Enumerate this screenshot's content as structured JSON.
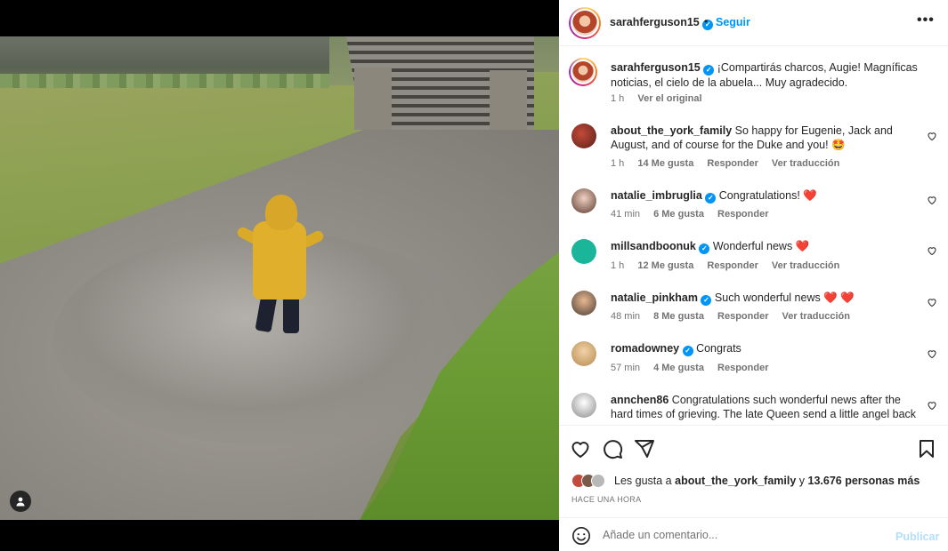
{
  "post": {
    "author": "sarahferguson15",
    "follow_label": "Seguir",
    "dot": "•",
    "more": "•••",
    "caption": "¡Compartirás charcos, Augie! Magníficas noticias, el cielo de la abuela... Muy agradecido.",
    "caption_time": "1 h",
    "caption_translate": "Ver el original"
  },
  "comments": [
    {
      "user": "about_the_york_family",
      "verified": false,
      "text": "So happy for Eugenie, Jack and August, and of course for the Duke and you! 🤩",
      "time": "1 h",
      "likes": "14 Me gusta",
      "reply": "Responder",
      "translate": "Ver traducción"
    },
    {
      "user": "natalie_imbruglia",
      "verified": true,
      "text": "Congratulations! ❤️",
      "time": "41 min",
      "likes": "6 Me gusta",
      "reply": "Responder"
    },
    {
      "user": "millsandboonuk",
      "verified": true,
      "text": "Wonderful news ❤️",
      "time": "1 h",
      "likes": "12 Me gusta",
      "reply": "Responder",
      "translate": "Ver traducción"
    },
    {
      "user": "natalie_pinkham",
      "verified": true,
      "text": "Such wonderful news ❤️ ❤️",
      "time": "48 min",
      "likes": "8 Me gusta",
      "reply": "Responder",
      "translate": "Ver traducción"
    },
    {
      "user": "romadowney",
      "verified": true,
      "text": "Congrats",
      "time": "57 min",
      "likes": "4 Me gusta",
      "reply": "Responder"
    },
    {
      "user": "annchen86",
      "verified": false,
      "text": "Congratulations such wonderful news after the hard times of grieving. The late Queen send a little angel back"
    }
  ],
  "likes": {
    "prefix": "Les gusta a",
    "first_liker": "about_the_york_family",
    "joiner": "y",
    "others": "13.676 personas más"
  },
  "time_ago": "HACE UNA HORA",
  "add_comment": {
    "placeholder": "Añade un comentario...",
    "publish_label": "Publicar"
  },
  "icons": {
    "verified": "✓",
    "like": "heart-icon",
    "comment": "comment-icon",
    "share": "share-icon",
    "save": "bookmark-icon",
    "emoji": "emoji-icon",
    "tag": "user-tag-icon"
  },
  "colors": {
    "accent": "#0095f6",
    "publish_disabled": "#b2dffc",
    "muted": "#737373",
    "text": "#262626",
    "heart": "#e0245e"
  }
}
